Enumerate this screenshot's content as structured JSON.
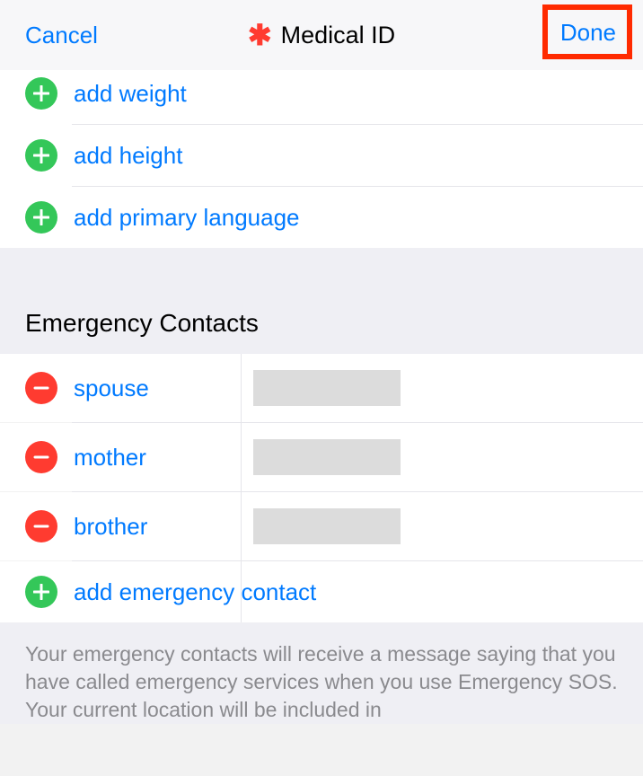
{
  "nav": {
    "cancel": "Cancel",
    "title": "Medical ID",
    "done": "Done"
  },
  "add_items": {
    "weight": "add weight",
    "height": "add height",
    "language": "add primary language",
    "emergency_contact": "add emergency contact"
  },
  "sections": {
    "emergency_contacts_header": "Emergency Contacts"
  },
  "contacts": {
    "items": [
      {
        "label": "spouse"
      },
      {
        "label": "mother"
      },
      {
        "label": "brother"
      }
    ]
  },
  "footer": "Your emergency contacts will receive a message saying that you have called emergency services when you use Emergency SOS. Your current location will be included in"
}
